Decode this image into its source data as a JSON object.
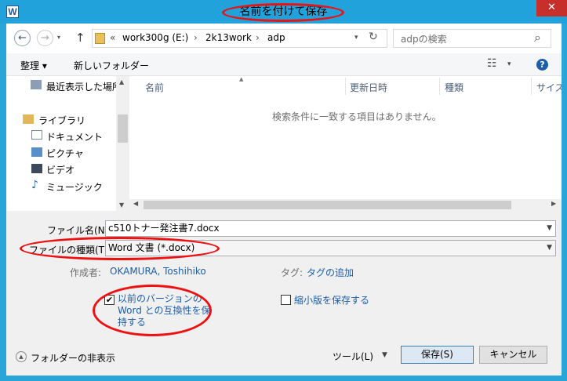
{
  "window": {
    "title": "名前を付けて保存",
    "app_icon": "W",
    "close_glyph": "✕"
  },
  "nav": {
    "back_glyph": "←",
    "forward_glyph": "→",
    "up_glyph": "↑",
    "chevron": "«",
    "breadcrumb": [
      "work300g (E:)",
      "2k13work",
      "adp"
    ],
    "sep": "›",
    "refresh_glyph": "↻",
    "search_placeholder": "adpの検索",
    "search_glyph": "⌕"
  },
  "toolbar": {
    "organize_label": "整理 ▾",
    "new_folder_label": "新しいフォルダー",
    "view_glyph": "☷",
    "help_glyph": "?"
  },
  "sidebar": {
    "recent": "最近表示した場所",
    "library": "ライブラリ",
    "items": [
      "ドキュメント",
      "ピクチャ",
      "ビデオ",
      "ミュージック"
    ]
  },
  "file_list": {
    "columns": [
      "名前",
      "更新日時",
      "種類",
      "サイズ"
    ],
    "empty_message": "検索条件に一致する項目はありません。"
  },
  "form": {
    "filename_label": "ファイル名(N):",
    "filename_value": "c510トナー発注書7.docx",
    "filetype_label": "ファイルの種類(T):",
    "filetype_value": "Word 文書 (*.docx)",
    "author_label": "作成者:",
    "author_value": "OKAMURA, Toshihiko",
    "tags_label": "タグ:",
    "tags_value": "タグの追加",
    "compat_checkbox_label": "以前のバージョンの Word との互換性を保持する",
    "compat_checked": true,
    "thumbnail_checkbox_label": "縮小版を保存する",
    "thumbnail_checked": false
  },
  "footer": {
    "hide_folders_label": "フォルダーの非表示",
    "tools_label": "ツール(L)",
    "save_label": "保存(S)",
    "cancel_label": "キャンセル"
  },
  "colors": {
    "titlebar": "#22a2da",
    "close": "#c7302a",
    "annotation": "#e11111",
    "link": "#1e5ea8"
  }
}
